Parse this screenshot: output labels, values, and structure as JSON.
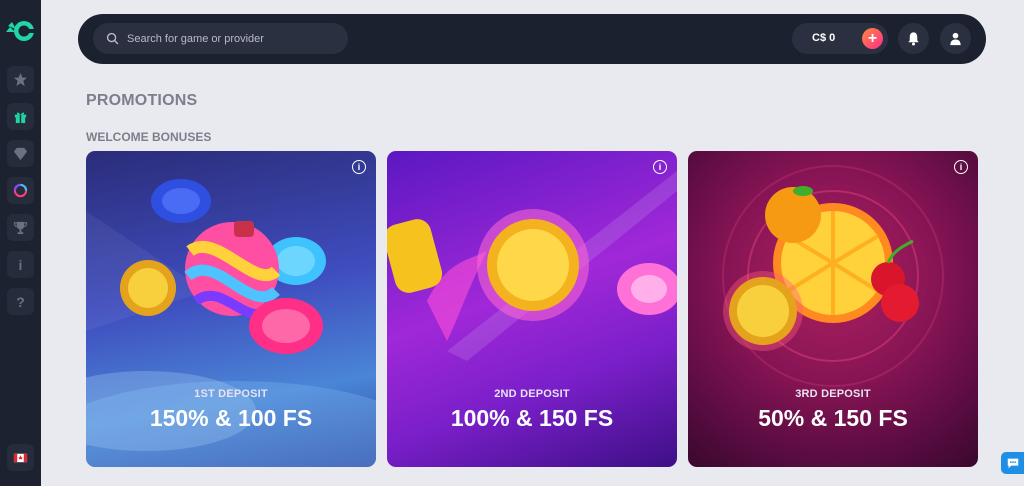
{
  "sidebar": {
    "items": [
      {
        "name": "favorites",
        "icon": "star-icon"
      },
      {
        "name": "promotions",
        "icon": "gift-icon",
        "active": true
      },
      {
        "name": "vip",
        "icon": "diamond-icon"
      },
      {
        "name": "wheel",
        "icon": "wheel-icon"
      },
      {
        "name": "tournaments",
        "icon": "trophy-icon"
      },
      {
        "name": "info",
        "icon": "info-icon",
        "glyph": "i"
      },
      {
        "name": "help",
        "icon": "help-icon",
        "glyph": "?"
      }
    ],
    "language_flag": "canada-flag-icon"
  },
  "header": {
    "search_placeholder": "Search for game or provider",
    "balance": "C$ 0",
    "deposit_symbol": "+"
  },
  "page": {
    "title": "PROMOTIONS",
    "section_title": "WELCOME BONUSES"
  },
  "cards": [
    {
      "label": "1ST DEPOSIT",
      "value": "150% & 100 FS",
      "info": "i"
    },
    {
      "label": "2ND DEPOSIT",
      "value": "100% & 150 FS",
      "info": "i"
    },
    {
      "label": "3RD DEPOSIT",
      "value": "50% & 150 FS",
      "info": "i"
    }
  ],
  "colors": {
    "sidebar_bg": "#1d2230",
    "header_bg": "#1c2130",
    "accent_green": "#1fd6a5",
    "page_bg": "#e9eaf0"
  }
}
